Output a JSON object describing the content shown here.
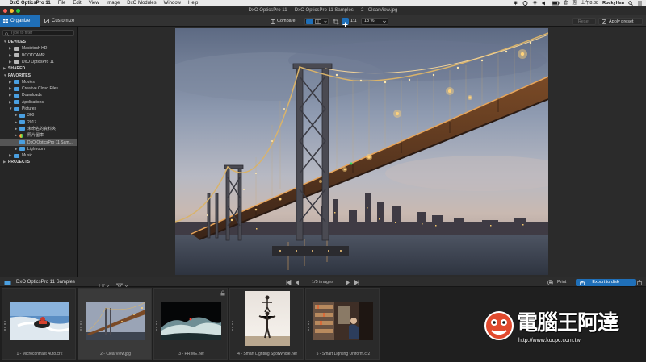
{
  "menubar": {
    "app_name": "DxO OpticsPro 11",
    "items": [
      "File",
      "Edit",
      "View",
      "Image",
      "DxO Modules",
      "Window",
      "Help"
    ],
    "clock": "週一上午8:38",
    "user": "RockyHsu"
  },
  "window": {
    "title": "DxO OpticsPro 11 — DxO OpticsPro 11 Samples — 2 - ClearView.jpg"
  },
  "toolbar": {
    "tab_organize": "Organize",
    "tab_customize": "Customize",
    "compare_label": "Compare",
    "ratio_label": "1:1",
    "zoom_value": "18 %",
    "reset_label": "Reset",
    "apply_preset_label": "Apply preset"
  },
  "search": {
    "placeholder": "Type to filter"
  },
  "tree": [
    {
      "label": "DEVICES",
      "header": true,
      "arrow": "▼"
    },
    {
      "label": "Macintosh HD",
      "arrow": "▶",
      "icon": "drive-icon"
    },
    {
      "label": "BOOTCAMP",
      "arrow": "▶",
      "icon": "drive-icon"
    },
    {
      "label": "DxO OpticsPro 11",
      "arrow": "▶",
      "icon": "drive-icon"
    },
    {
      "label": "SHARED",
      "header": true,
      "arrow": "▶"
    },
    {
      "label": "FAVORITES",
      "header": true,
      "arrow": "▼"
    },
    {
      "label": "Movies",
      "arrow": "▶",
      "icon": "folder-icon"
    },
    {
      "label": "Creative Cloud Files",
      "arrow": "▶",
      "icon": "folder-icon"
    },
    {
      "label": "Downloads",
      "arrow": "▶",
      "icon": "folder-icon"
    },
    {
      "label": "Applications",
      "arrow": "▶",
      "icon": "folder-icon"
    },
    {
      "label": "Pictures",
      "arrow": "▼",
      "icon": "folder-icon"
    },
    {
      "label": "360",
      "arrow": "▶",
      "icon": "folder-icon"
    },
    {
      "label": "2017",
      "arrow": "▶",
      "icon": "folder-icon"
    },
    {
      "label": "未命名的資料夾",
      "arrow": "▶",
      "icon": "folder-icon"
    },
    {
      "label": "照片圖庫",
      "arrow": "▶",
      "icon": "photos-icon"
    },
    {
      "label": "DxO OpticsPro 11 Sam...",
      "arrow": "",
      "icon": "folder-icon",
      "selected": true
    },
    {
      "label": "Lightroom",
      "arrow": "▶",
      "icon": "folder-icon"
    },
    {
      "label": "Music",
      "arrow": "▶",
      "icon": "folder-icon"
    },
    {
      "label": "PROJECTS",
      "header": true,
      "arrow": "▶"
    }
  ],
  "filmstrip": {
    "folder_label": "DxO OpticsPro 11 Samples",
    "count_label": "1/5 images",
    "print_label": "Print",
    "export_label": "Export to disk",
    "thumbs": [
      {
        "caption": "1 - Microcontrast Auto.cr2"
      },
      {
        "caption": "2 - ClearView.jpg"
      },
      {
        "caption": "3 - PRIME.nef"
      },
      {
        "caption": "4 - Smart Lighting SpotWhole.nef"
      },
      {
        "caption": "5 - Smart Lighting Uniform.cr2"
      }
    ]
  },
  "watermark": {
    "title": "電腦王阿達",
    "url": "http://www.kocpc.com.tw"
  },
  "colors": {
    "accent_blue": "#1f6fb8",
    "folder_blue": "#4a9fe0"
  }
}
